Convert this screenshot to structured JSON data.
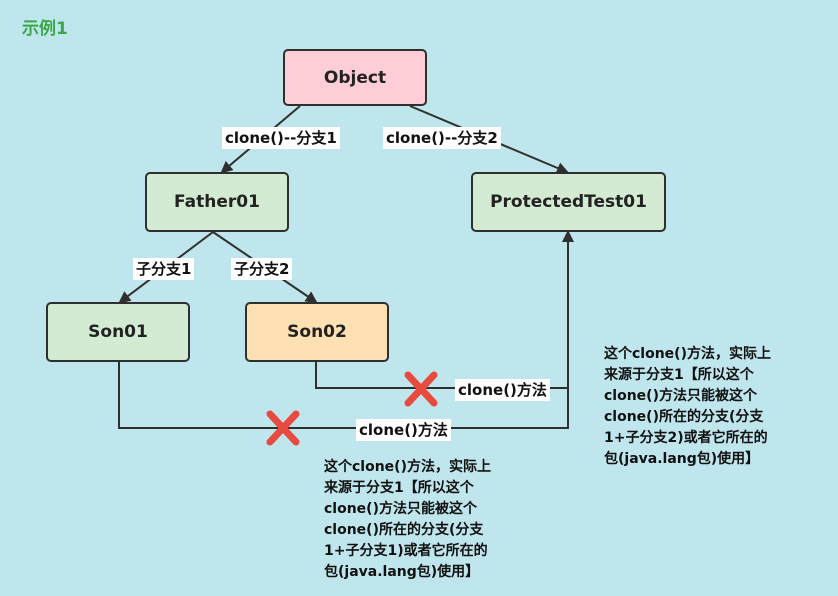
{
  "title": "示例1",
  "nodes": {
    "object": "Object",
    "father01": "Father01",
    "protected_test01": "ProtectedTest01",
    "son01": "Son01",
    "son02": "Son02"
  },
  "edge_labels": {
    "branch1": "clone()--分支1",
    "branch2": "clone()--分支2",
    "sub_branch1": "子分支1",
    "sub_branch2": "子分支2",
    "son02_call": "clone()方法",
    "son01_call": "clone()方法"
  },
  "notes": {
    "right": "这个clone()方法，实际上\n来源于分支1【所以这个\nclone()方法只能被这个\nclone()所在的分支(分支\n1+子分支2)或者它所在的\n包(java.lang包)使用】",
    "bottom": "这个clone()方法，实际上\n来源于分支1【所以这个\nclone()方法只能被这个\nclone()所在的分支(分支\n1+子分支1)或者它所在的\n包(java.lang包)使用】"
  },
  "colors": {
    "background": "#bfe6ec",
    "object_fill": "#ffcdd5",
    "class_fill": "#d2ebd2",
    "son02_fill": "#ffe0b3",
    "forbidden_mark": "#e84a3f",
    "title": "#3aa84a"
  },
  "icons": [
    "cross-mark-icon",
    "cross-mark-icon"
  ]
}
